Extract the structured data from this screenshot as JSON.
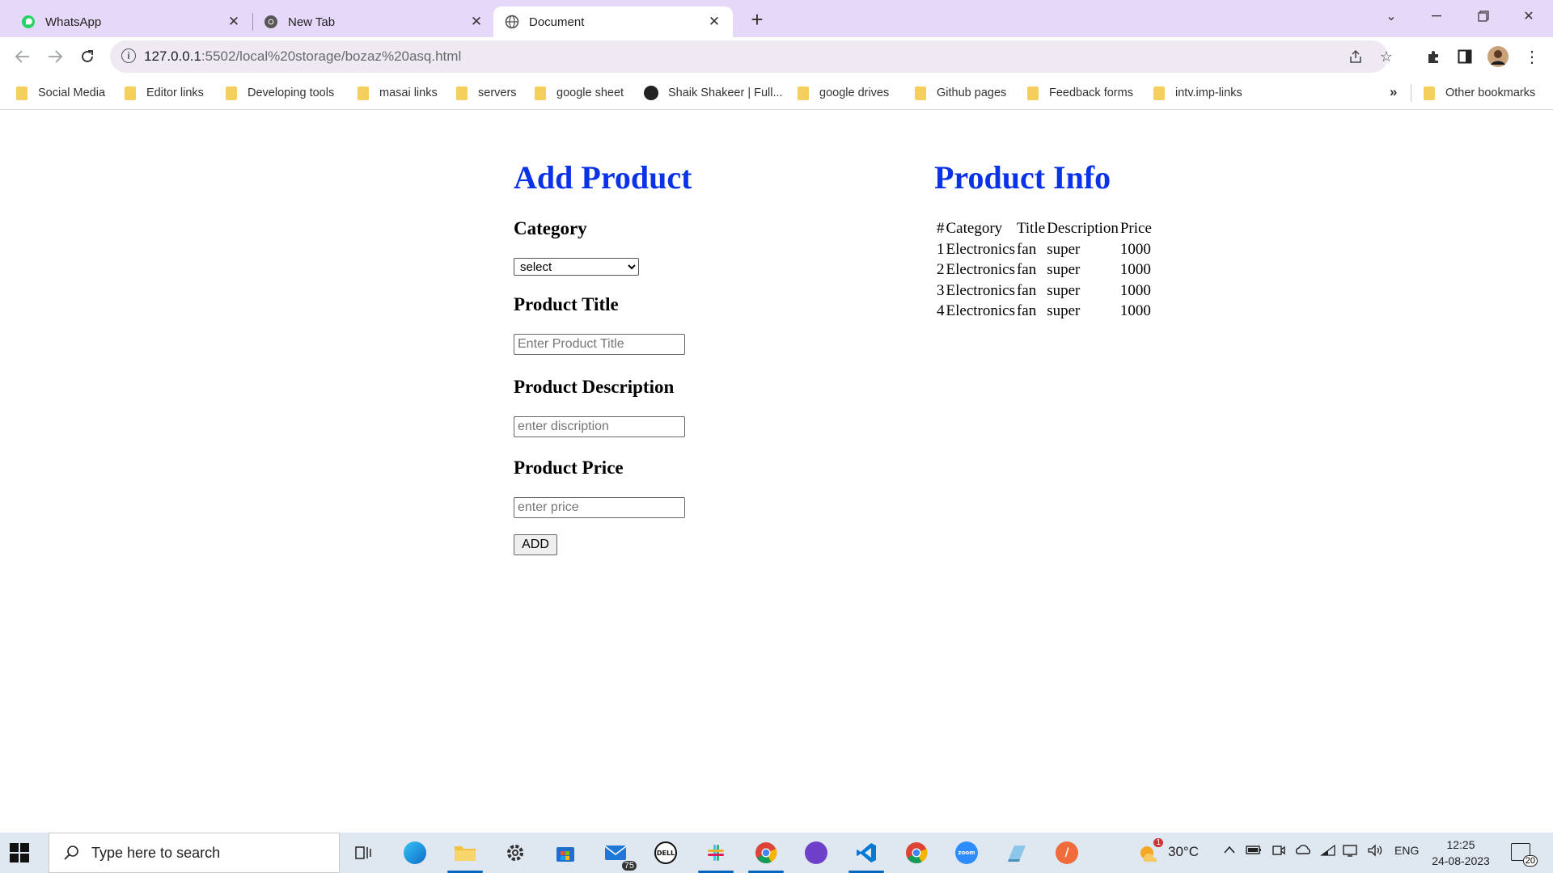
{
  "browser": {
    "tabs": [
      {
        "title": "WhatsApp",
        "icon": "whatsapp-icon",
        "active": false
      },
      {
        "title": "New Tab",
        "icon": "chrome-icon",
        "active": false
      },
      {
        "title": "Document",
        "icon": "globe-icon",
        "active": true
      }
    ],
    "address": {
      "host": "127.0.0.1",
      "path": ":5502/local%20storage/bozaz%20asq.html"
    },
    "bookmarks": [
      {
        "label": "Social Media",
        "icon": "folder-icon"
      },
      {
        "label": "Editor links",
        "icon": "folder-icon"
      },
      {
        "label": "Developing tools",
        "icon": "folder-icon"
      },
      {
        "label": "masai links",
        "icon": "folder-icon"
      },
      {
        "label": "servers",
        "icon": "folder-icon"
      },
      {
        "label": "google sheet",
        "icon": "folder-icon"
      },
      {
        "label": "Shaik Shakeer | Full...",
        "icon": "globe-icon"
      },
      {
        "label": "google drives",
        "icon": "folder-icon"
      },
      {
        "label": "Github pages",
        "icon": "folder-icon"
      },
      {
        "label": "Feedback forms",
        "icon": "folder-icon"
      },
      {
        "label": "intv.imp-links",
        "icon": "folder-icon"
      }
    ],
    "bookmarks_more": "»",
    "other_bookmarks": "Other bookmarks"
  },
  "form": {
    "heading": "Add Product",
    "category_label": "Category",
    "category_selected": "select",
    "title_label": "Product Title",
    "title_placeholder": "Enter Product Title",
    "description_label": "Product Description",
    "description_placeholder": "enter discription",
    "price_label": "Product Price",
    "price_placeholder": "enter price",
    "add_button": "ADD"
  },
  "info": {
    "heading": "Product Info",
    "columns": [
      "#",
      "Category",
      "Title",
      "Description",
      "Price"
    ],
    "rows": [
      [
        "1",
        "Electronics",
        "fan",
        "super",
        "1000"
      ],
      [
        "2",
        "Electronics",
        "fan",
        "super",
        "1000"
      ],
      [
        "3",
        "Electronics",
        "fan",
        "super",
        "1000"
      ],
      [
        "4",
        "Electronics",
        "fan",
        "super",
        "1000"
      ]
    ]
  },
  "taskbar": {
    "search_placeholder": "Type here to search",
    "mail_badge": "75",
    "weather_alert": "1",
    "temperature": "30°C",
    "language": "ENG",
    "time": "12:25",
    "date": "24-08-2023",
    "notifications": "20",
    "colors": {
      "accent": "#0067c0",
      "heading": "#0a32e6",
      "tabstrip": "#e6d8f8"
    }
  }
}
